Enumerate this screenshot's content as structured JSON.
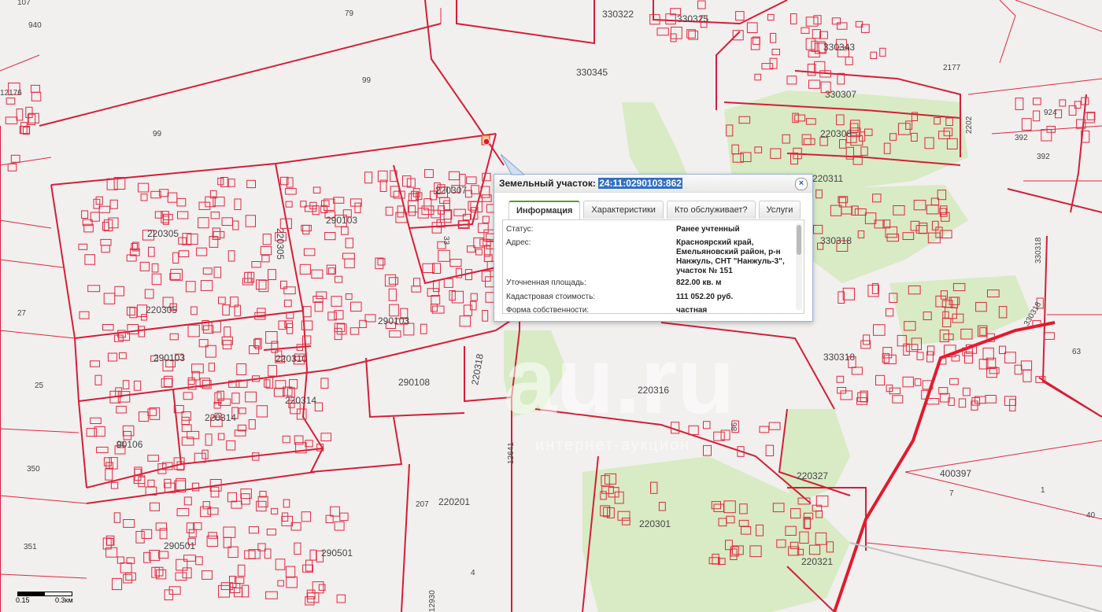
{
  "map": {
    "labels": {
      "l107": "107",
      "l79": "79",
      "l940": "940",
      "l99a": "99",
      "l99b": "99",
      "l12176": "12176",
      "l330322": "330322",
      "l330325": "330325",
      "l330345": "330345",
      "l330343": "330343",
      "l2177": "2177",
      "l330307": "330307",
      "l220308": "220308",
      "l2202": "2202",
      "l392a": "392",
      "l392b": "392",
      "l924": "924",
      "l220307": "220307",
      "l290103a": "290103",
      "l220305a": "220305",
      "l220305b": "220305",
      "l220305c": "220305",
      "l220311": "220311",
      "l330318a": "330318",
      "l330318b": "330318",
      "l330318c": "330318",
      "l330318d": "330318",
      "l27": "27",
      "l290103b": "290103",
      "l290103c": "290103",
      "l220310": "220310",
      "l220318": "220318",
      "l25": "25",
      "l290108": "290108",
      "l220316": "220316",
      "l220314a": "220314",
      "l220314b": "220314",
      "l63": "63",
      "l90106": "90106",
      "l350": "350",
      "l12641": "12641",
      "l220327": "220327",
      "l400397": "400397",
      "l207": "207",
      "l220201": "220201",
      "l7": "7",
      "l1": "1",
      "l220301": "220301",
      "l40": "40",
      "l351": "351",
      "l290501a": "290501",
      "l290501b": "290501",
      "l4": "4",
      "l220321": "220321",
      "l12930": "12930",
      "l33": "33",
      "l86": "86"
    },
    "watermark": "au.ru",
    "watermark_sub": "интернет-аукцион"
  },
  "popup": {
    "title_prefix": "Земельный участок:",
    "cadastral_number": "24:11:0290103:862",
    "close": "×",
    "tabs": [
      "Информация",
      "Характеристики",
      "Кто обслуживает?",
      "Услуги"
    ],
    "rows": [
      {
        "label": "Статус:",
        "value": "Ранее учтенный"
      },
      {
        "label": "Адрес:",
        "value": "Красноярский край, Емельяновский район, р-н Нанжуль, СНТ \"Нанжуль-3\", участок № 151"
      },
      {
        "label": "Уточненная площадь:",
        "value": "822.00 кв. м"
      },
      {
        "label": "Кадастровая стоимость:",
        "value": "111 052.20 руб."
      },
      {
        "label": "Форма собственности:",
        "value": "частная"
      }
    ]
  },
  "scale": {
    "mid": "0.15",
    "end": "0.3км"
  },
  "colors": {
    "boundary": "#e0283c",
    "green": "#d8ebc4",
    "bg": "#f2efef",
    "selected": "#e8a23a"
  }
}
